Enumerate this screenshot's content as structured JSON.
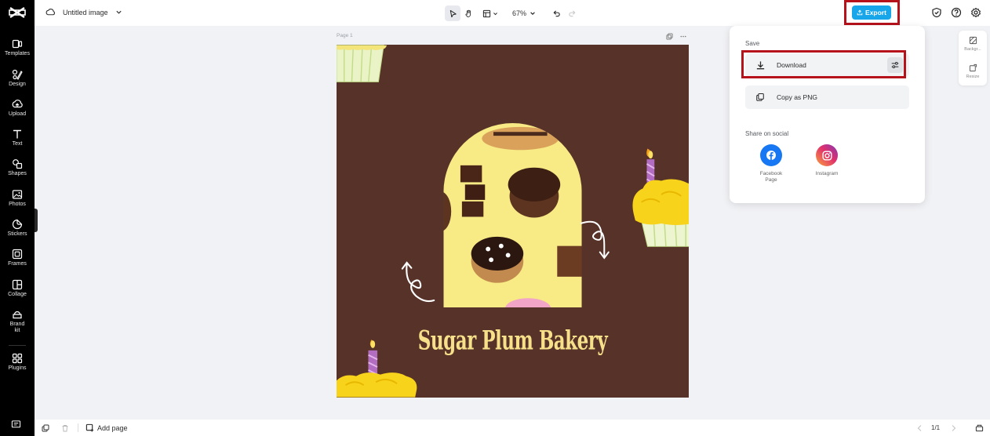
{
  "sidebar": {
    "items": [
      {
        "label": "Templates",
        "icon": "templates-icon"
      },
      {
        "label": "Design",
        "icon": "design-icon"
      },
      {
        "label": "Upload",
        "icon": "upload-icon"
      },
      {
        "label": "Text",
        "icon": "text-icon"
      },
      {
        "label": "Shapes",
        "icon": "shapes-icon"
      },
      {
        "label": "Photos",
        "icon": "photos-icon"
      },
      {
        "label": "Stickers",
        "icon": "stickers-icon"
      },
      {
        "label": "Frames",
        "icon": "frames-icon"
      },
      {
        "label": "Collage",
        "icon": "collage-icon"
      },
      {
        "label": "Brand kit",
        "icon": "brand-kit-icon"
      },
      {
        "label": "Plugins",
        "icon": "plugins-icon"
      }
    ]
  },
  "topbar": {
    "doc_title": "Untitled image",
    "zoom": "67%",
    "export_label": "Export"
  },
  "canvas": {
    "page_label": "Page 1",
    "headline": "Sugar Plum Bakery"
  },
  "export_panel": {
    "save_heading": "Save",
    "download_label": "Download",
    "copy_png_label": "Copy as PNG",
    "share_heading": "Share on social",
    "social": [
      {
        "label": "Facebook Page",
        "color": "#1877f2"
      },
      {
        "label": "Instagram",
        "color": "#d62976"
      }
    ]
  },
  "right_panel": {
    "background_label": "Backgr...",
    "resize_label": "Resize"
  },
  "bottombar": {
    "add_page_label": "Add page",
    "page_counter": "1/1"
  },
  "colors": {
    "accent": "#18a6ea",
    "highlight": "#b5121b",
    "artboard_bg": "#573229",
    "title_color": "#f7e08a"
  }
}
